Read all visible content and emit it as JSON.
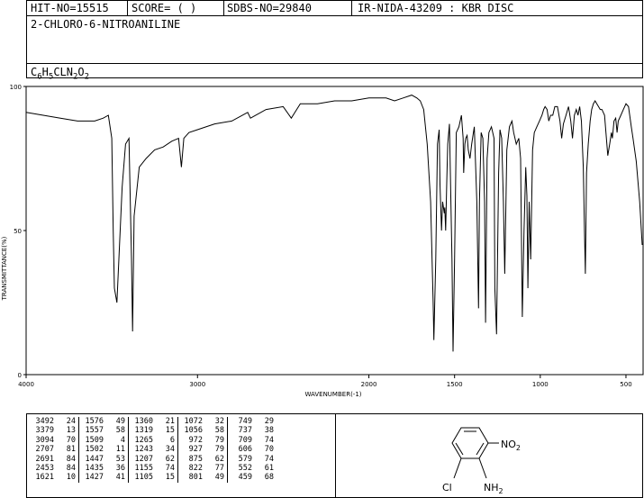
{
  "header": {
    "hit_no": "HIT-NO=15515",
    "score": "SCORE=  (   )",
    "sdbs_no": "SDBS-NO=29840",
    "ir_nida": "IR-NIDA-43209 : KBR DISC"
  },
  "compound": {
    "name": "2-CHLORO-6-NITROANILINE",
    "formula_parts": [
      "C",
      "6",
      "H",
      "5",
      "CLN",
      "2",
      "O",
      "2"
    ]
  },
  "structure": {
    "label_no2": "NO",
    "label_no2_sub": "2",
    "label_cl": "Cl",
    "label_nh2": "NH",
    "label_nh2_sub": "2"
  },
  "chart_data": {
    "type": "line",
    "xlabel": "WAVENUMBER(-1)",
    "ylabel": "TRANSMITTANCE(%)",
    "xlim": [
      4000,
      400
    ],
    "ylim": [
      0,
      100
    ],
    "x_ticks": [
      4000,
      3000,
      2000,
      1500,
      1000,
      500
    ],
    "y_ticks": [
      0,
      50,
      100
    ],
    "series": [
      {
        "x": [
          4000,
          3900,
          3800,
          3700,
          3600,
          3550,
          3520,
          3500,
          3492,
          3485,
          3470,
          3440,
          3420,
          3400,
          3385,
          3379,
          3370,
          3340,
          3300,
          3250,
          3200,
          3150,
          3110,
          3094,
          3080,
          3050,
          3000,
          2900,
          2800,
          2707,
          2691,
          2600,
          2500,
          2453,
          2400,
          2300,
          2200,
          2100,
          2000,
          1950,
          1900,
          1850,
          1800,
          1750,
          1720,
          1700,
          1680,
          1660,
          1640,
          1625,
          1621,
          1610,
          1600,
          1590,
          1585,
          1576,
          1570,
          1560,
          1557,
          1552,
          1545,
          1540,
          1530,
          1515,
          1509,
          1500,
          1490,
          1475,
          1460,
          1450,
          1447,
          1440,
          1435,
          1427,
          1420,
          1410,
          1400,
          1390,
          1385,
          1370,
          1360,
          1355,
          1345,
          1335,
          1325,
          1319,
          1310,
          1300,
          1285,
          1270,
          1265,
          1255,
          1243,
          1235,
          1225,
          1215,
          1207,
          1195,
          1180,
          1165,
          1155,
          1140,
          1125,
          1115,
          1105,
          1095,
          1085,
          1078,
          1072,
          1065,
          1056,
          1045,
          1035,
          1020,
          1005,
          990,
          980,
          972,
          960,
          950,
          940,
          927,
          915,
          900,
          885,
          875,
          865,
          850,
          835,
          822,
          812,
          801,
          790,
          780,
          770,
          760,
          749,
          742,
          737,
          730,
          720,
          709,
          700,
          690,
          680,
          670,
          660,
          650,
          640,
          625,
          606,
          595,
          585,
          579,
          570,
          560,
          552,
          545,
          530,
          515,
          500,
          485,
          469,
          459,
          440,
          420,
          405
        ],
        "y": [
          91,
          90,
          89,
          88,
          88,
          89,
          90,
          82,
          50,
          30,
          25,
          65,
          80,
          82,
          40,
          15,
          55,
          72,
          75,
          78,
          79,
          81,
          82,
          72,
          82,
          84,
          85,
          87,
          88,
          91,
          89,
          92,
          93,
          89,
          94,
          94,
          95,
          95,
          96,
          96,
          96,
          95,
          96,
          97,
          96,
          95,
          92,
          80,
          60,
          25,
          12,
          40,
          80,
          85,
          66,
          50,
          60,
          56,
          58,
          50,
          68,
          80,
          87,
          40,
          8,
          40,
          84,
          86,
          90,
          82,
          70,
          80,
          82,
          83,
          78,
          75,
          80,
          84,
          86,
          60,
          23,
          60,
          84,
          82,
          60,
          18,
          75,
          84,
          86,
          82,
          30,
          14,
          70,
          85,
          82,
          60,
          35,
          78,
          86,
          88,
          84,
          80,
          82,
          75,
          20,
          50,
          72,
          62,
          30,
          60,
          40,
          78,
          84,
          86,
          88,
          90,
          92,
          93,
          92,
          88,
          90,
          90,
          93,
          93,
          88,
          82,
          87,
          90,
          93,
          88,
          82,
          90,
          92,
          90,
          93,
          88,
          72,
          50,
          35,
          70,
          80,
          88,
          92,
          94,
          95,
          94,
          93,
          92,
          92,
          90,
          76,
          80,
          84,
          82,
          88,
          89,
          84,
          88,
          90,
          92,
          94,
          93,
          86,
          82,
          74,
          60,
          45
        ]
      }
    ]
  },
  "peak_table": {
    "columns": [
      [
        [
          "3492",
          "24"
        ],
        [
          "3379",
          "13"
        ],
        [
          "3094",
          "70"
        ],
        [
          "2707",
          "81"
        ],
        [
          "2691",
          "84"
        ],
        [
          "2453",
          "84"
        ],
        [
          "1621",
          "10"
        ]
      ],
      [
        [
          "1576",
          "49"
        ],
        [
          "1557",
          "58"
        ],
        [
          "1509",
          "4"
        ],
        [
          "1502",
          "11"
        ],
        [
          "1447",
          "53"
        ],
        [
          "1435",
          "36"
        ],
        [
          "1427",
          "41"
        ]
      ],
      [
        [
          "1360",
          "21"
        ],
        [
          "1319",
          "15"
        ],
        [
          "1265",
          "6"
        ],
        [
          "1243",
          "34"
        ],
        [
          "1207",
          "62"
        ],
        [
          "1155",
          "74"
        ],
        [
          "1105",
          "15"
        ]
      ],
      [
        [
          "1072",
          "32"
        ],
        [
          "1056",
          "58"
        ],
        [
          "972",
          "79"
        ],
        [
          "927",
          "79"
        ],
        [
          "875",
          "62"
        ],
        [
          "822",
          "77"
        ],
        [
          "801",
          "49"
        ]
      ],
      [
        [
          "749",
          "29"
        ],
        [
          "737",
          "38"
        ],
        [
          "709",
          "74"
        ],
        [
          "606",
          "70"
        ],
        [
          "579",
          "74"
        ],
        [
          "552",
          "61"
        ],
        [
          "459",
          "68"
        ]
      ]
    ]
  }
}
